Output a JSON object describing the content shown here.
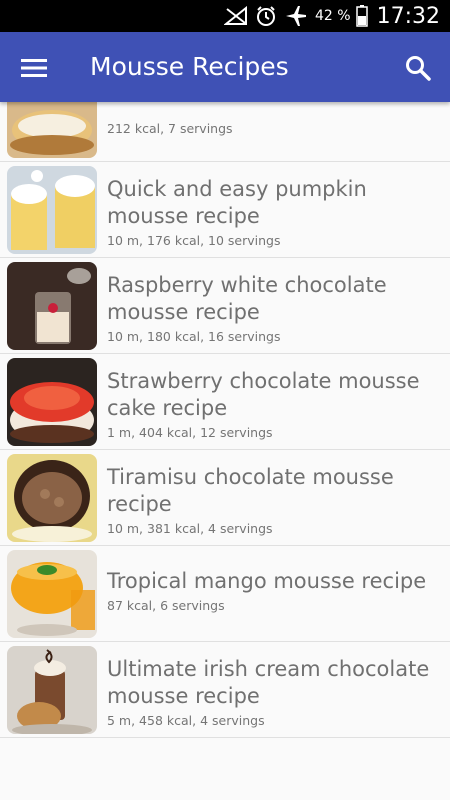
{
  "status_bar": {
    "battery_percent": "42 %",
    "time": "17:32",
    "icons": [
      "no-signal-icon",
      "alarm-icon",
      "airplane-icon",
      "battery-icon"
    ]
  },
  "app_bar": {
    "title": "Mousse Recipes",
    "menu_icon": "hamburger-menu-icon",
    "search_icon": "search-icon"
  },
  "recipes": [
    {
      "title": "",
      "meta": "212 kcal, 7 servings"
    },
    {
      "title": "Quick and easy pumpkin mousse recipe",
      "meta": "10 m, 176 kcal, 10 servings"
    },
    {
      "title": "Raspberry white chocolate mousse recipe",
      "meta": "10 m, 180 kcal, 16 servings"
    },
    {
      "title": "Strawberry chocolate mousse cake recipe",
      "meta": "1 m, 404 kcal, 12 servings"
    },
    {
      "title": "Tiramisu chocolate mousse recipe",
      "meta": "10 m, 381 kcal, 4 servings"
    },
    {
      "title": "Tropical mango mousse recipe",
      "meta": "87 kcal, 6 servings"
    },
    {
      "title": "Ultimate irish cream chocolate mousse recipe",
      "meta": "5 m, 458 kcal, 4 servings"
    }
  ],
  "colors": {
    "app_bar": "#3f51b5",
    "status_bar": "#000000",
    "title_text": "#707070",
    "meta_text": "#757575"
  }
}
